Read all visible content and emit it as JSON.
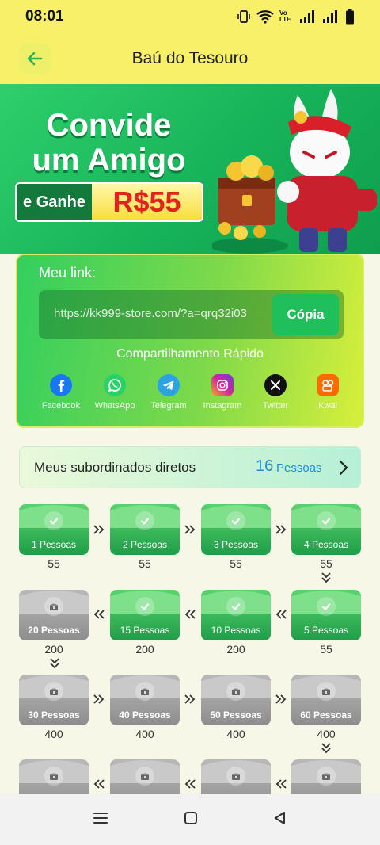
{
  "status": {
    "time": "08:01",
    "network_label": "Vo LTE"
  },
  "header": {
    "title": "Baú do Tesouro",
    "back_icon": "arrow-left-icon"
  },
  "banner": {
    "line1": "Convide",
    "line2": "um Amigo",
    "earn_label": "e Ganhe",
    "amount": "R$55"
  },
  "invite": {
    "link_label": "Meu link:",
    "link_value": "https://kk999-store.com/?a=qrq32i03",
    "copy_label": "Cópia",
    "share_label": "Compartilhamento Rápido",
    "share_items": [
      {
        "label": "Facebook",
        "icon": "facebook-icon",
        "color": "#1877f2"
      },
      {
        "label": "WhatsApp",
        "icon": "whatsapp-icon",
        "color": "#25d366"
      },
      {
        "label": "Telegram",
        "icon": "telegram-icon",
        "color": "#2aa3e0"
      },
      {
        "label": "Instagram",
        "icon": "instagram-icon",
        "color": "#d6249f"
      },
      {
        "label": "Twitter",
        "icon": "x-icon",
        "color": "#111111"
      },
      {
        "label": "Kwai",
        "icon": "kwai-icon",
        "color": "#ff6a00"
      }
    ]
  },
  "subordinates": {
    "label": "Meus subordinados diretos",
    "count": "16",
    "unit": "Pessoas"
  },
  "chests": {
    "row1": [
      {
        "label": "1 Pessoas",
        "reward": "55",
        "state": "done"
      },
      {
        "label": "2 Pessoas",
        "reward": "55",
        "state": "done"
      },
      {
        "label": "3 Pessoas",
        "reward": "55",
        "state": "done"
      },
      {
        "label": "4 Pessoas",
        "reward": "55",
        "state": "done"
      }
    ],
    "row2": [
      {
        "label": "20 Pessoas",
        "reward": "200",
        "state": "locked"
      },
      {
        "label": "15 Pessoas",
        "reward": "200",
        "state": "done"
      },
      {
        "label": "10 Pessoas",
        "reward": "200",
        "state": "done"
      },
      {
        "label": "5 Pessoas",
        "reward": "55",
        "state": "done"
      }
    ],
    "row3": [
      {
        "label": "30 Pessoas",
        "reward": "400",
        "state": "locked"
      },
      {
        "label": "40 Pessoas",
        "reward": "400",
        "state": "locked"
      },
      {
        "label": "50 Pessoas",
        "reward": "400",
        "state": "locked"
      },
      {
        "label": "60 Pessoas",
        "reward": "400",
        "state": "locked"
      }
    ]
  },
  "colors": {
    "header_bg": "#f9f06a",
    "accent_green": "#1fbf5b",
    "count_blue": "#1b8fd4",
    "amount_red": "#e0231c"
  }
}
